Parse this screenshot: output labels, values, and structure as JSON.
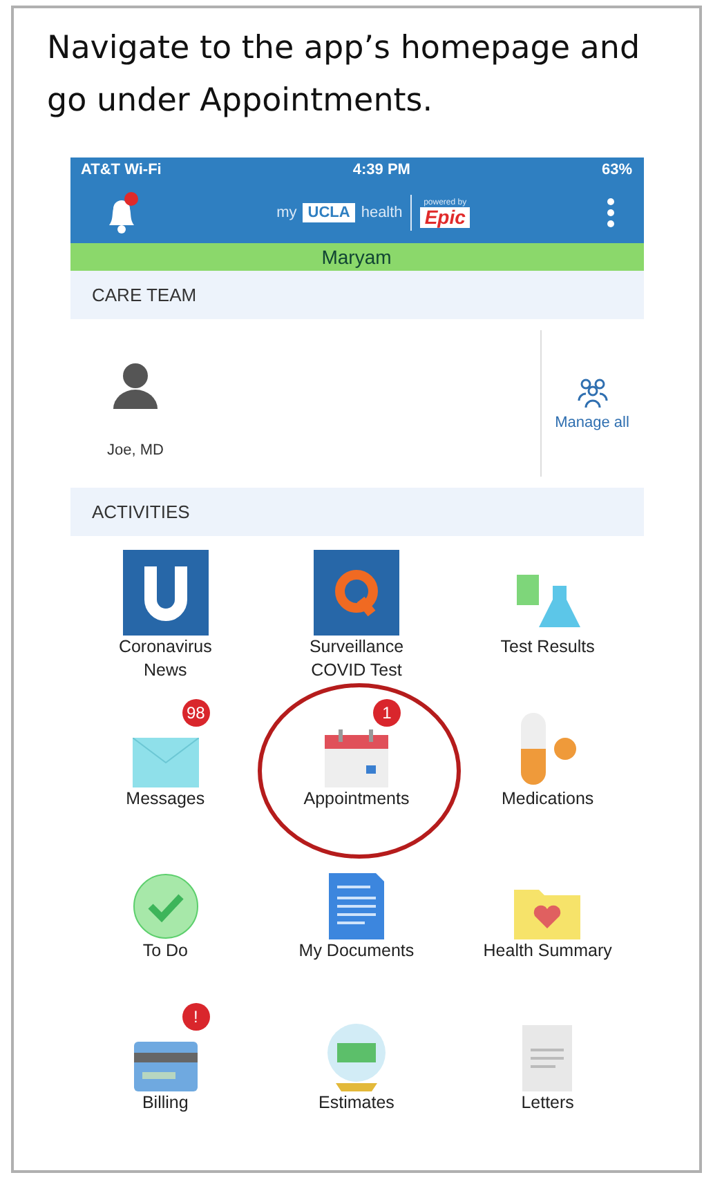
{
  "instruction": "Navigate to the app’s homepage and go under Appointments.",
  "status_bar": {
    "carrier": "AT&T Wi-Fi",
    "time": "4:39 PM",
    "battery": "63%"
  },
  "header": {
    "logo_my": "my",
    "logo_ucla": "UCLA",
    "logo_health": "health",
    "powered_by": "powered by",
    "epic": "Epic",
    "notification_dot": true
  },
  "profile_bar": {
    "name": "Maryam"
  },
  "care_team": {
    "title": "CARE TEAM",
    "members": [
      {
        "name": "Joe, MD"
      }
    ],
    "manage": "Manage all"
  },
  "activities": {
    "title": "ACTIVITIES",
    "items": [
      {
        "kind": "news",
        "label": "Coronavirus News",
        "highlighted": false
      },
      {
        "kind": "covid",
        "label": "Surveillance COVID Test",
        "highlighted": false
      },
      {
        "kind": "lab",
        "label": "Test Results",
        "highlighted": false
      },
      {
        "kind": "mail",
        "label": "Messages",
        "badge": "98",
        "highlighted": false
      },
      {
        "kind": "calendar",
        "label": "Appointments",
        "badge": "1",
        "highlighted": true
      },
      {
        "kind": "pill",
        "label": "Medications",
        "highlighted": false
      },
      {
        "kind": "check",
        "label": "To Do",
        "highlighted": false
      },
      {
        "kind": "document",
        "label": "My Documents",
        "highlighted": false
      },
      {
        "kind": "folder",
        "label": "Health Summary",
        "highlighted": false
      },
      {
        "kind": "card",
        "label": "Billing",
        "badge": "!",
        "highlighted": false
      },
      {
        "kind": "money",
        "label": "Estimates",
        "highlighted": false
      },
      {
        "kind": "letter",
        "label": "Letters",
        "highlighted": false
      }
    ]
  }
}
